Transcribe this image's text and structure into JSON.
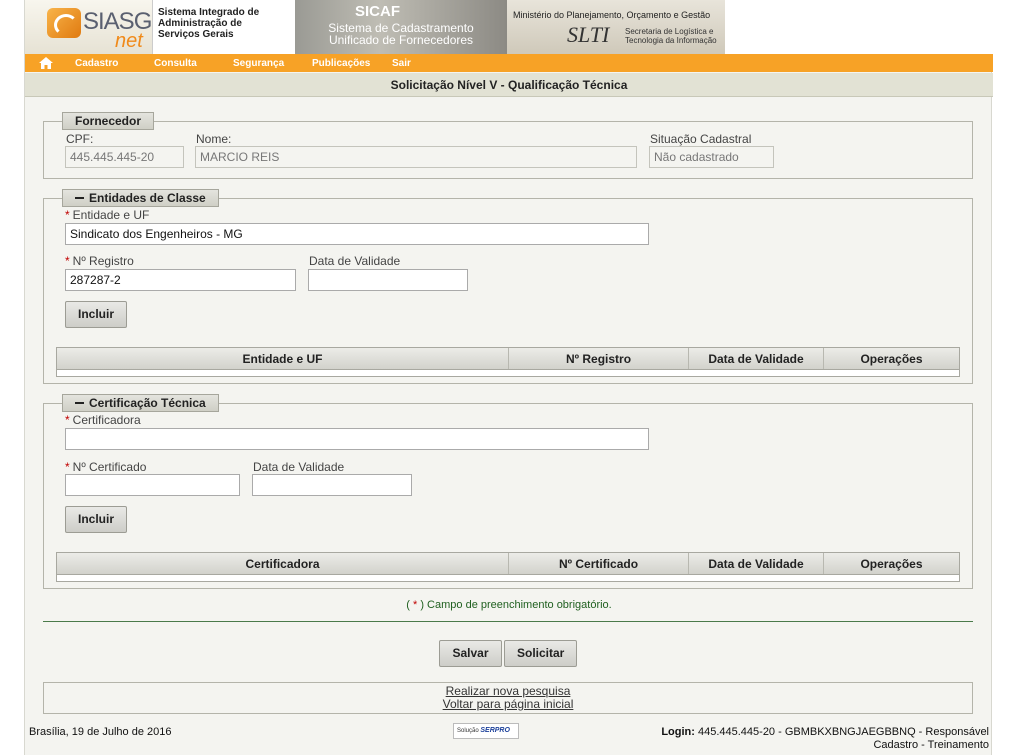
{
  "header": {
    "logo_text": "SIASG",
    "logo_suffix": "net",
    "system_name_lines": [
      "Sistema Integrado de",
      "Administração de",
      "Serviços Gerais"
    ],
    "sicaf_title": "SICAF",
    "sicaf_subtitle_lines": [
      "Sistema de Cadastramento",
      "Unificado de Fornecedores"
    ],
    "ministry": "Ministério do Planejamento, Orçamento e Gestão",
    "slti": "SLTI",
    "slti_sub_lines": [
      "Secretaria de Logística e",
      "Tecnologia da Informação"
    ]
  },
  "nav": {
    "home_icon": "home-icon",
    "items": [
      "Cadastro",
      "Consulta",
      "Segurança",
      "Publicações",
      "Sair"
    ]
  },
  "page_title": "Solicitação Nível V - Qualificação Técnica",
  "fornecedor": {
    "legend": "Fornecedor",
    "cpf_label": "CPF:",
    "cpf_value": "445.445.445-20",
    "nome_label": "Nome:",
    "nome_value": "MARCIO REIS",
    "situacao_label": "Situação Cadastral",
    "situacao_value": "Não cadastrado"
  },
  "entidades": {
    "legend": "Entidades de Classe",
    "entidade_label": "Entidade e UF",
    "entidade_value": "Sindicato dos Engenheiros - MG",
    "registro_label": "Nº Registro",
    "registro_value": "287287-2",
    "validade_label": "Data de Validade",
    "validade_value": "",
    "incluir_label": "Incluir",
    "columns": [
      "Entidade e UF",
      "Nº Registro",
      "Data de Validade",
      "Operações"
    ]
  },
  "certificacao": {
    "legend": "Certificação Técnica",
    "certificadora_label": "Certificadora",
    "certificadora_value": "",
    "certificado_label": "Nº Certificado",
    "certificado_value": "",
    "validade_label": "Data de Validade",
    "validade_value": "",
    "incluir_label": "Incluir",
    "columns": [
      "Certificadora",
      "Nº Certificado",
      "Data de Validade",
      "Operações"
    ]
  },
  "required_note": {
    "open": "( ",
    "star": "*",
    "close": " ) Campo de preenchimento obrigatório."
  },
  "actions": {
    "salvar": "Salvar",
    "solicitar": "Solicitar"
  },
  "links": {
    "nova_pesquisa": "Realizar nova pesquisa",
    "voltar": "Voltar para página inicial"
  },
  "footer": {
    "date": "Brasília, 19 de Julho de 2016",
    "serpro_prefix": "Solução",
    "serpro": "SERPRO",
    "login_label": "Login:",
    "login_value": " 445.445.445-20  - GBMBKXBNGJAEGBBNQ - Responsável",
    "login_line2": "Cadastro - Treinamento"
  },
  "colors": {
    "nav_bg": "#f7a226",
    "note_green": "#206020",
    "required_red": "#c00000"
  }
}
